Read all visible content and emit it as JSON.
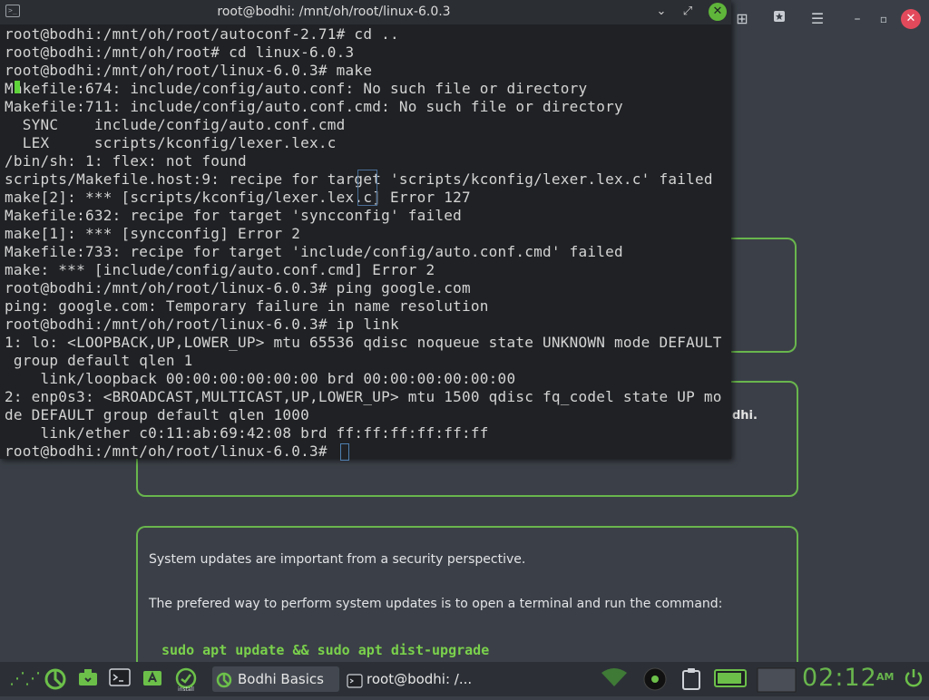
{
  "terminal": {
    "title": "root@bodhi: /mnt/oh/root/linux-6.0.3",
    "controls": {
      "minimize": "⌄",
      "maximize": "⤢",
      "close": "✕"
    },
    "lines": [
      "root@bodhi:/mnt/oh/root/autoconf-2.71# cd ..",
      "root@bodhi:/mnt/oh/root# cd linux-6.0.3",
      "root@bodhi:/mnt/oh/root/linux-6.0.3# make",
      "Makefile:674: include/config/auto.conf: No such file or directory",
      "Makefile:711: include/config/auto.conf.cmd: No such file or directory",
      "  SYNC    include/config/auto.conf.cmd",
      "  LEX     scripts/kconfig/lexer.lex.c",
      "/bin/sh: 1: flex: not found",
      "scripts/Makefile.host:9: recipe for target 'scripts/kconfig/lexer.lex.c' failed",
      "make[2]: *** [scripts/kconfig/lexer.lex.c] Error 127",
      "Makefile:632: recipe for target 'syncconfig' failed",
      "make[1]: *** [syncconfig] Error 2",
      "Makefile:733: recipe for target 'include/config/auto.conf.cmd' failed",
      "make: *** [include/config/auto.conf.cmd] Error 2",
      "root@bodhi:/mnt/oh/root/linux-6.0.3# ping google.com",
      "ping: google.com: Temporary failure in name resolution",
      "root@bodhi:/mnt/oh/root/linux-6.0.3# ip link",
      "1: lo: <LOOPBACK,UP,LOWER_UP> mtu 65536 qdisc noqueue state UNKNOWN mode DEFAULT",
      " group default qlen 1",
      "    link/loopback 00:00:00:00:00:00 brd 00:00:00:00:00:00",
      "2: enp0s3: <BROADCAST,MULTICAST,UP,LOWER_UP> mtu 1500 qdisc fq_codel state UP mo",
      "de DEFAULT group default qlen 1000",
      "    link/ether c0:11:ab:69:42:08 brd ff:ff:ff:ff:ff:ff",
      "root@bodhi:/mnt/oh/root/linux-6.0.3# "
    ]
  },
  "browser": {
    "toolbar_icons": [
      "add-tab-icon",
      "bookmark-star-icon",
      "menu-icon",
      "minimize-icon",
      "restore-icon",
      "close-icon"
    ],
    "card2_tail": "dhi.",
    "card3": {
      "para1": "System updates are important from a security perspective.",
      "para2": "The prefered way to perform system updates is to open a terminal and run the command:",
      "command": "sudo apt update && sudo apt dist-upgrade"
    }
  },
  "taskbar": {
    "tasks": [
      {
        "label": "Bodhi Basics",
        "active": true
      },
      {
        "label": "root@bodhi: /...",
        "active": false
      }
    ],
    "install_label": "install",
    "clock": "02:12",
    "ampm": "AM"
  },
  "colors": {
    "accent_green": "#69b64d",
    "terminal_bg": "#1f2124",
    "desktop_bg": "#3a3f47",
    "close_red": "#e24a5c"
  }
}
